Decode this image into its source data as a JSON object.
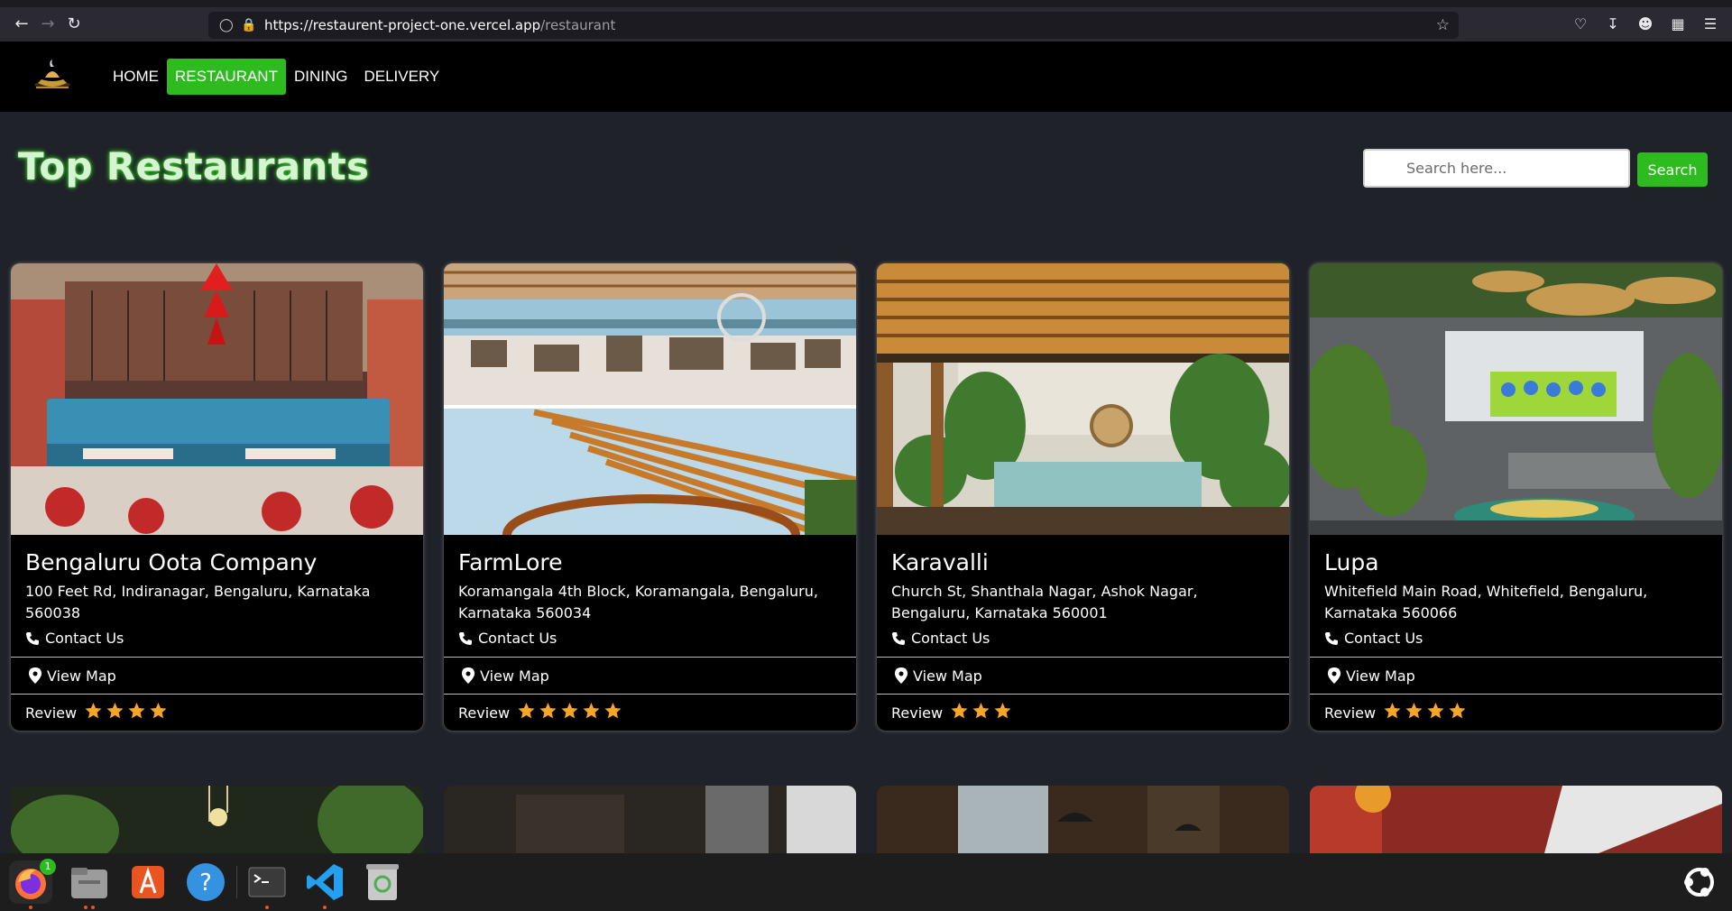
{
  "browser": {
    "url_host": "https://restaurent-project-one.vercel.app",
    "url_path": "/restaurant"
  },
  "nav": {
    "links": [
      "HOME",
      "RESTAURANT",
      "DINING",
      "DELIVERY"
    ],
    "active": "RESTAURANT"
  },
  "page": {
    "title": "Top Restaurants",
    "search_placeholder": "Search here...",
    "search_button": "Search"
  },
  "restaurants": [
    {
      "name": "Bengaluru Oota Company",
      "address": "100 Feet Rd, Indiranagar, Bengaluru, Karnataka 560038",
      "contact_label": "Contact Us",
      "map_label": "View Map",
      "review_label": "Review",
      "stars": 4
    },
    {
      "name": "FarmLore",
      "address": "Koramangala 4th Block, Koramangala, Bengaluru, Karnataka 560034",
      "contact_label": "Contact Us",
      "map_label": "View Map",
      "review_label": "Review",
      "stars": 5
    },
    {
      "name": "Karavalli",
      "address": "Church St, Shanthala Nagar, Ashok Nagar, Bengaluru, Karnataka 560001",
      "contact_label": "Contact Us",
      "map_label": "View Map",
      "review_label": "Review",
      "stars": 3
    },
    {
      "name": "Lupa",
      "address": "Whitefield Main Road, Whitefield, Bengaluru, Karnataka 560066",
      "contact_label": "Contact Us",
      "map_label": "View Map",
      "review_label": "Review",
      "stars": 4
    }
  ],
  "dock": {
    "firefox_badge": "1",
    "icons": [
      "firefox-icon",
      "files-icon",
      "app-center-icon",
      "help-icon",
      "terminal-icon",
      "vscode-icon",
      "trash-icon",
      "ubuntu-icon"
    ]
  },
  "colors": {
    "accent": "#2dbb1f",
    "star": "#f5a623",
    "background": "#1f2228"
  }
}
